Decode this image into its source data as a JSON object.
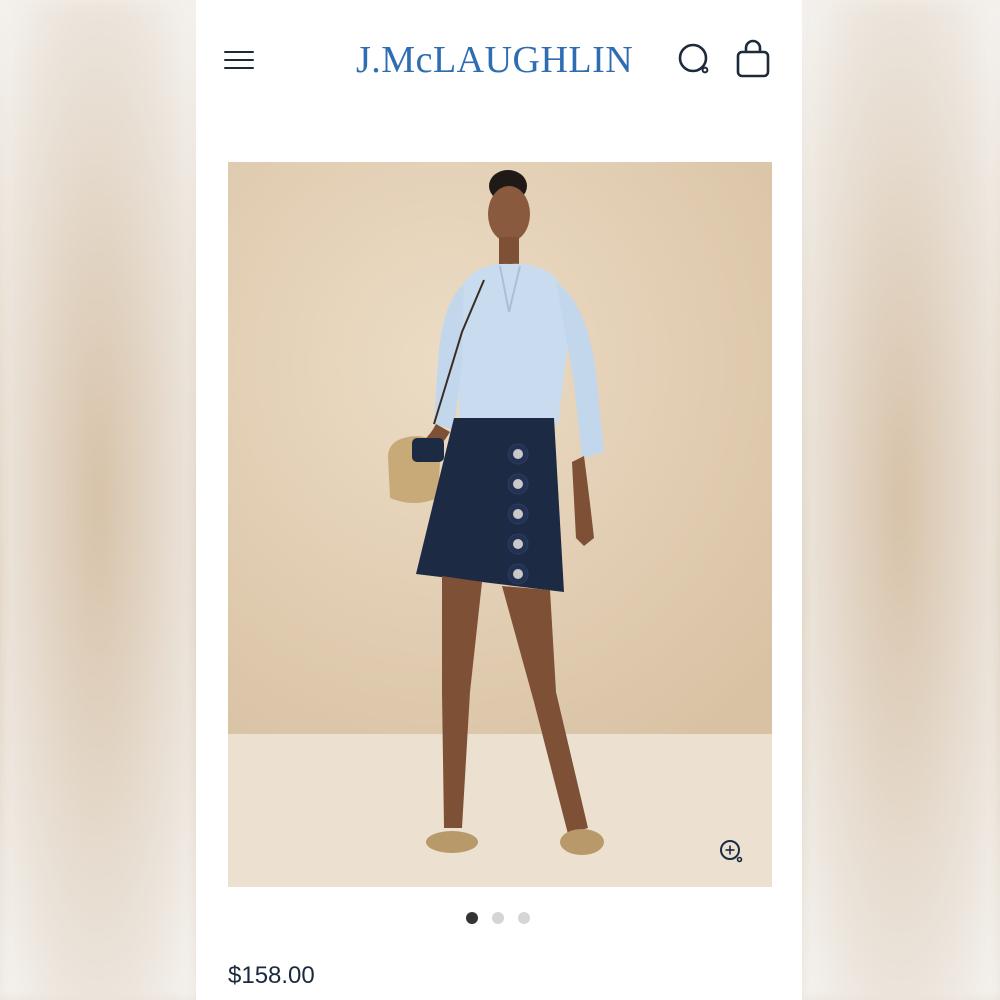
{
  "header": {
    "brand": "J.McLAUGHLIN",
    "menu_icon": "hamburger-menu-icon",
    "search_icon": "search-icon",
    "bag_icon": "shopping-bag-icon"
  },
  "product": {
    "image_alt": "Model wearing light blue blouse and navy scalloped-edge mini skirt",
    "zoom_icon": "zoom-in-icon",
    "pager": {
      "count": 3,
      "active_index": 0
    },
    "price": "$158.00"
  },
  "colors": {
    "brand_blue": "#2f6db3",
    "icon_navy": "#1d2a3a",
    "skirt_navy": "#1c2a44",
    "blouse_blue": "#c9dcef",
    "backdrop_beige": "#e3cfb4"
  }
}
